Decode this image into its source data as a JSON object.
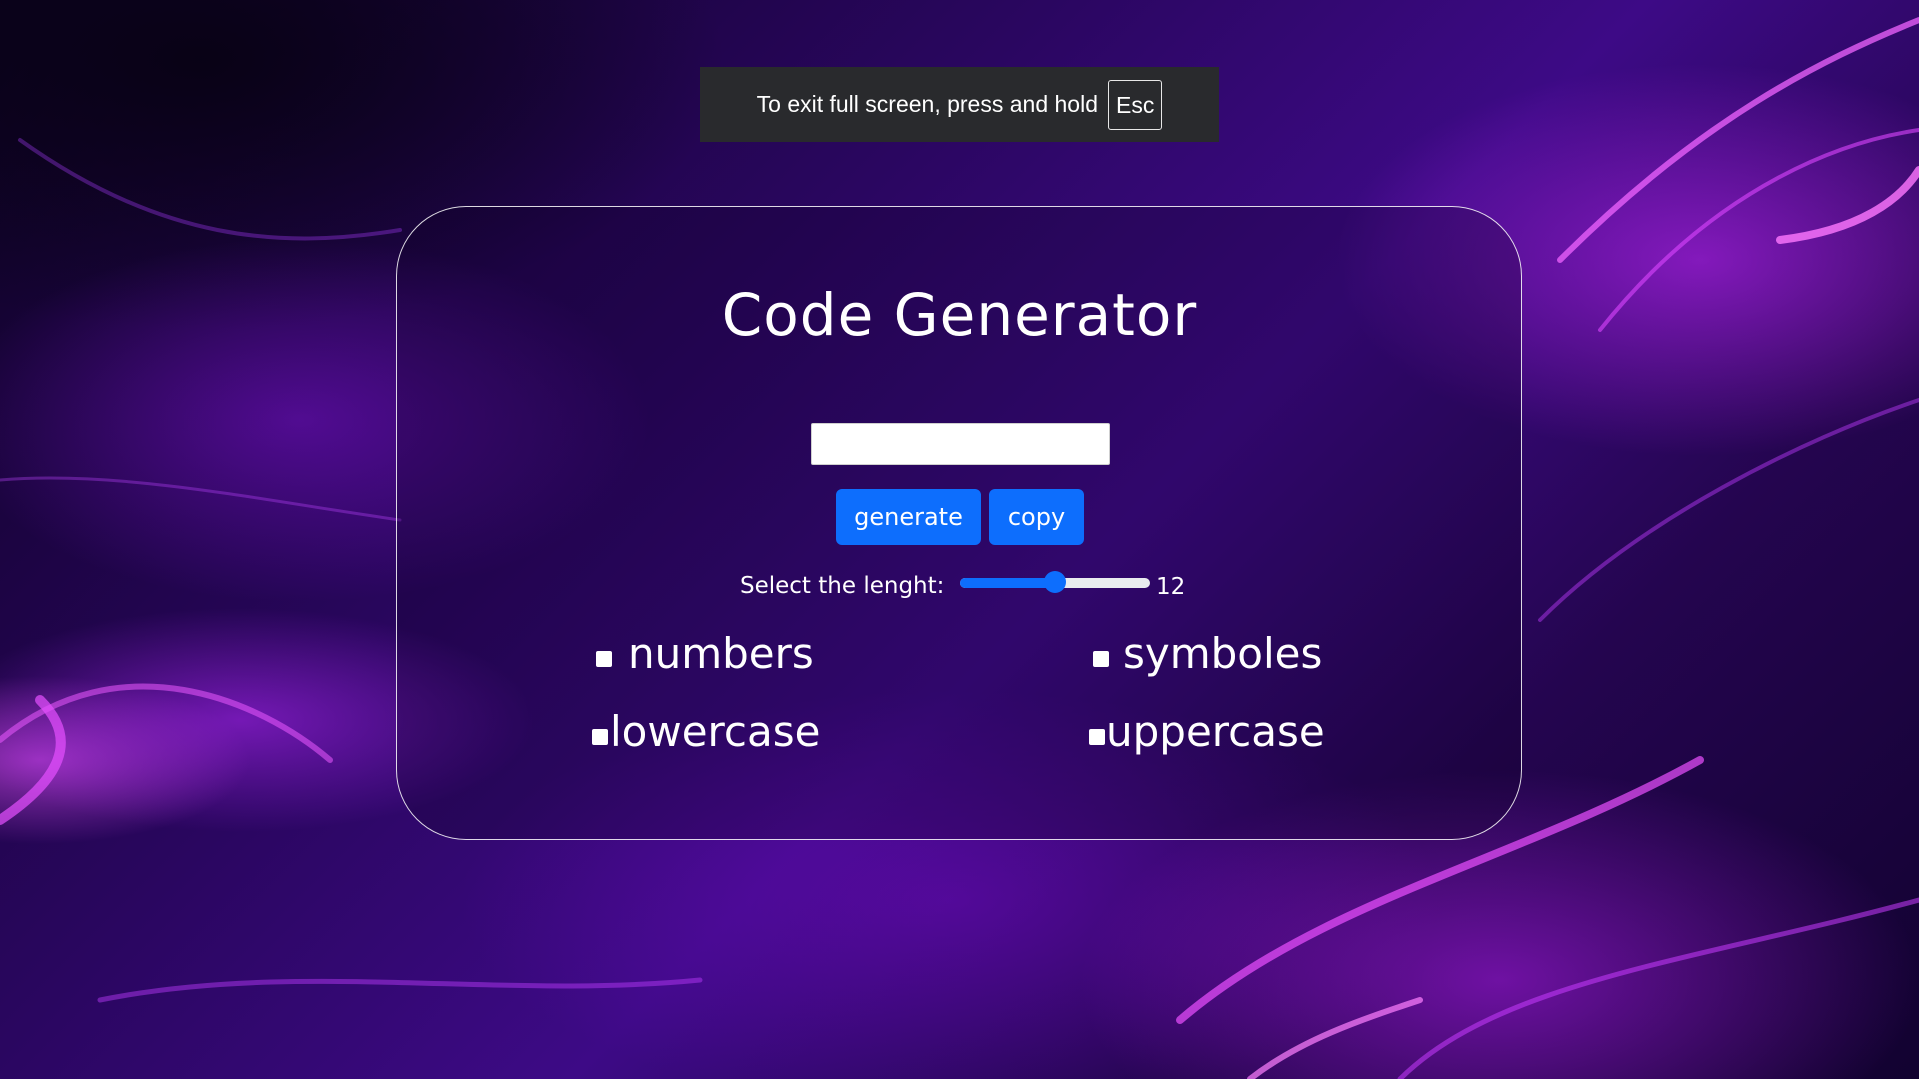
{
  "fullscreen_notice": {
    "text": "To exit full screen, press and hold",
    "key": "Esc"
  },
  "app": {
    "title": "Code Generator"
  },
  "code_output": {
    "value": "",
    "placeholder": ""
  },
  "buttons": {
    "generate": "generate",
    "copy": "copy"
  },
  "length": {
    "label": "Select the lenght:",
    "value": "12",
    "min": 4,
    "max": 20,
    "current": 12
  },
  "options": {
    "numbers": {
      "label": "numbers",
      "checked": false
    },
    "symboles": {
      "label": "symboles",
      "checked": false
    },
    "lowercase": {
      "label": "lowercase",
      "checked": false
    },
    "uppercase": {
      "label": "uppercase",
      "checked": false
    }
  },
  "colors": {
    "accent": "#0d6efd",
    "toast_bg": "#292a2d",
    "background_purple": "#3d0a86"
  }
}
